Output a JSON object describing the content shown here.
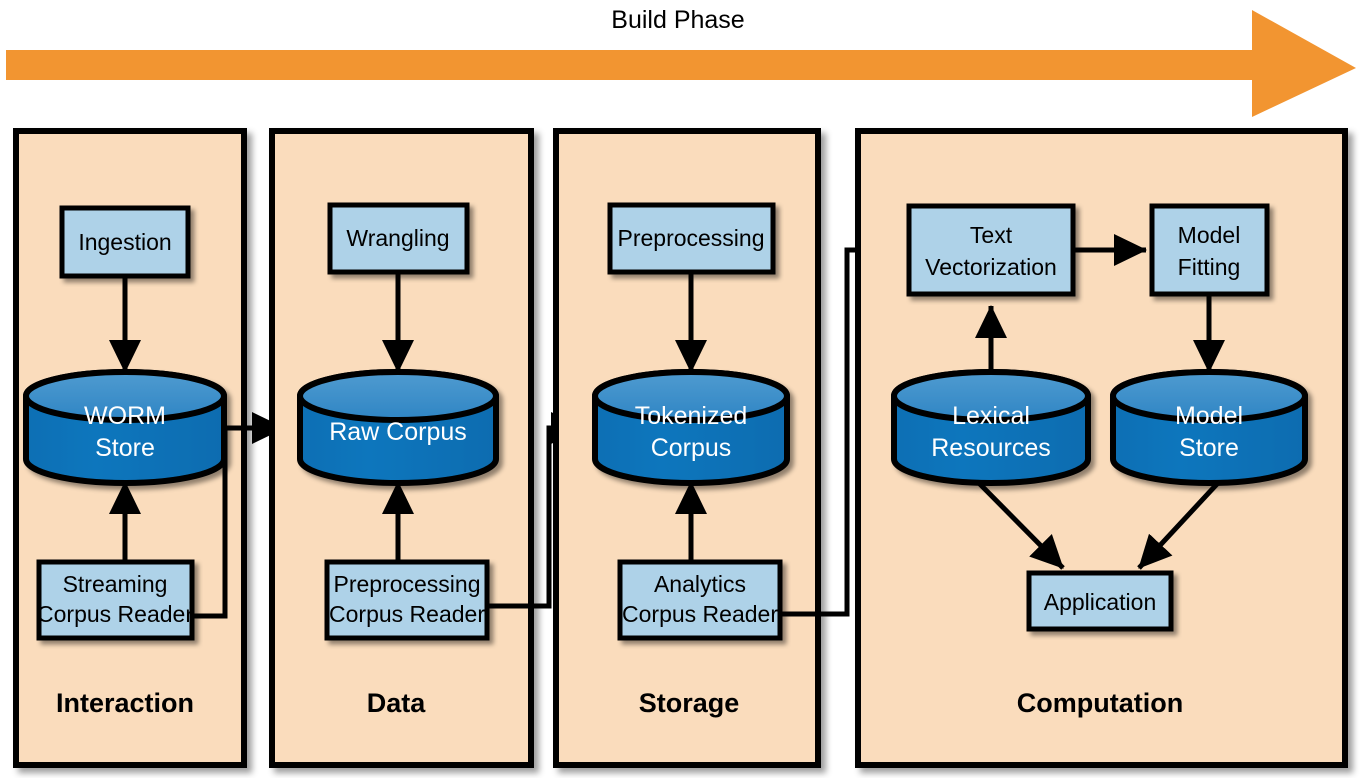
{
  "header": {
    "phase_title": "Build Phase",
    "arrow_color": "#f29531",
    "arrow_name": "build-phase-arrow"
  },
  "colors": {
    "panel_bg": "#fadcbc",
    "panel_border": "#000000",
    "box_fill": "#aed2e8",
    "cylinder_body": "#0c74ba",
    "cylinder_top": "#3a8dc8",
    "connector": "#000000",
    "text_dark": "#000000",
    "text_light": "#ffffff"
  },
  "panels": [
    {
      "id": "interaction",
      "label": "Interaction",
      "process_box": "Ingestion",
      "store": "WORM Store",
      "store_lines": [
        "WORM",
        "Store"
      ],
      "reader": "Streaming Corpus Reader",
      "reader_lines": [
        "Streaming",
        "Corpus Reader"
      ]
    },
    {
      "id": "data",
      "label": "Data",
      "process_box": "Wrangling",
      "store": "Raw Corpus",
      "store_lines": [
        "Raw Corpus"
      ],
      "reader": "Preprocessing Corpus Reader",
      "reader_lines": [
        "Preprocessing",
        "Corpus Reader"
      ]
    },
    {
      "id": "storage",
      "label": "Storage",
      "process_box": "Preprocessing",
      "store": "Tokenized Corpus",
      "store_lines": [
        "Tokenized",
        "Corpus"
      ],
      "reader": "Analytics Corpus Reader",
      "reader_lines": [
        "Analytics",
        "Corpus Reader"
      ]
    },
    {
      "id": "computation",
      "label": "Computation",
      "nodes": {
        "text_vectorization": [
          "Text",
          "Vectorization"
        ],
        "model_fitting": [
          "Model",
          "Fitting"
        ],
        "lexical_resources": [
          "Lexical",
          "Resources"
        ],
        "model_store": [
          "Model",
          "Store"
        ],
        "application": [
          "Application"
        ]
      }
    }
  ],
  "flows": [
    {
      "from": "Ingestion",
      "to": "WORM Store"
    },
    {
      "from": "Streaming Corpus Reader",
      "to": "WORM Store"
    },
    {
      "from": "Streaming Corpus Reader",
      "to": "Raw Corpus"
    },
    {
      "from": "Wrangling",
      "to": "Raw Corpus"
    },
    {
      "from": "Preprocessing Corpus Reader",
      "to": "Raw Corpus"
    },
    {
      "from": "Preprocessing Corpus Reader",
      "to": "Tokenized Corpus"
    },
    {
      "from": "Preprocessing",
      "to": "Tokenized Corpus"
    },
    {
      "from": "Analytics Corpus Reader",
      "to": "Tokenized Corpus"
    },
    {
      "from": "Analytics Corpus Reader",
      "to": "Text Vectorization"
    },
    {
      "from": "Lexical Resources",
      "to": "Text Vectorization"
    },
    {
      "from": "Text Vectorization",
      "to": "Model Fitting"
    },
    {
      "from": "Model Fitting",
      "to": "Model Store"
    },
    {
      "from": "Lexical Resources",
      "to": "Application"
    },
    {
      "from": "Model Store",
      "to": "Application"
    }
  ]
}
